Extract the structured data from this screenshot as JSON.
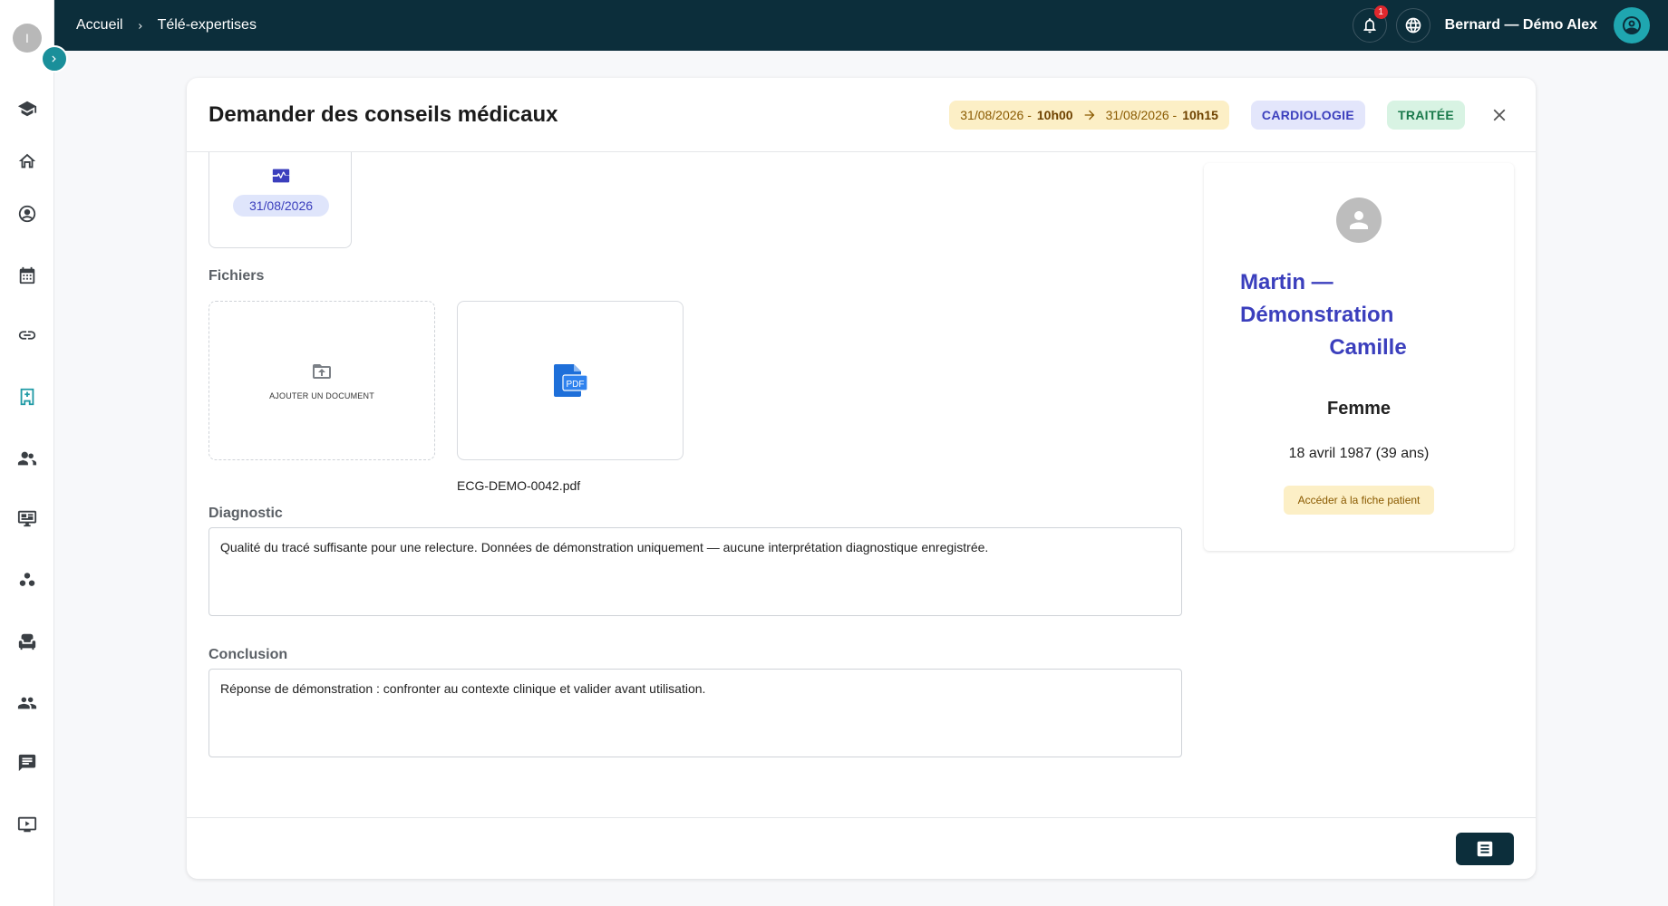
{
  "app": {
    "logo_letter": "I"
  },
  "sidebar": {
    "items": [
      {
        "icon": "graduation-cap-icon",
        "active": false
      },
      {
        "icon": "home-icon",
        "active": false
      },
      {
        "icon": "doctor-avatar-icon",
        "active": false
      },
      {
        "icon": "calendar-icon",
        "active": false
      },
      {
        "icon": "link-icon",
        "active": false
      },
      {
        "icon": "hospital-icon",
        "active": true
      },
      {
        "icon": "user-group-add-icon",
        "active": false
      },
      {
        "icon": "monitor-icon",
        "active": false
      },
      {
        "icon": "workspaces-icon",
        "active": false
      },
      {
        "icon": "armchair-icon",
        "active": false
      },
      {
        "icon": "people-icon",
        "active": false
      },
      {
        "icon": "chat-icon",
        "active": false
      },
      {
        "icon": "video-play-icon",
        "active": false
      }
    ]
  },
  "topbar": {
    "breadcrumb": [
      "Accueil",
      "Télé-expertises"
    ],
    "notifications_count": "1",
    "user_name": "Bernard — Démo Alex"
  },
  "modal": {
    "title": "Demander des conseils médicaux",
    "start_date": "31/08/2026 - ",
    "start_time": "10h00",
    "end_date": "31/08/2026 - ",
    "end_time": "10h15",
    "specialty_tag": "CARDIOLOGIE",
    "status_tag": "TRAITÉE",
    "exam_card_date": "31/08/2026",
    "files_label": "Fichiers",
    "add_document_label": "AJOUTER UN DOCUMENT",
    "file_name": "ECG-DEMO-0042.pdf",
    "diagnostic_label": "Diagnostic",
    "diagnostic_text": "Qualité du tracé suffisante pour une relecture. Données de démonstration uniquement — aucune interprétation diagnostique enregistrée.",
    "conclusion_label": "Conclusion",
    "conclusion_text": "Réponse de démonstration : confronter au contexte clinique et valider avant utilisation."
  },
  "patient": {
    "name_line1": "Martin —",
    "name_line2": "Démonstration",
    "name_line3": "Camille",
    "sex": "Femme",
    "dob": "18 avril 1987 (39 ans)",
    "open_file_button": "Accéder à la fiche patient"
  },
  "colors": {
    "topbar": "#0c2e3b",
    "accent_teal": "#1f9aa5",
    "accent_indigo": "#3b3fbd",
    "date_pill_bg": "#fcefc6",
    "status_bg": "#d8f3e3"
  }
}
